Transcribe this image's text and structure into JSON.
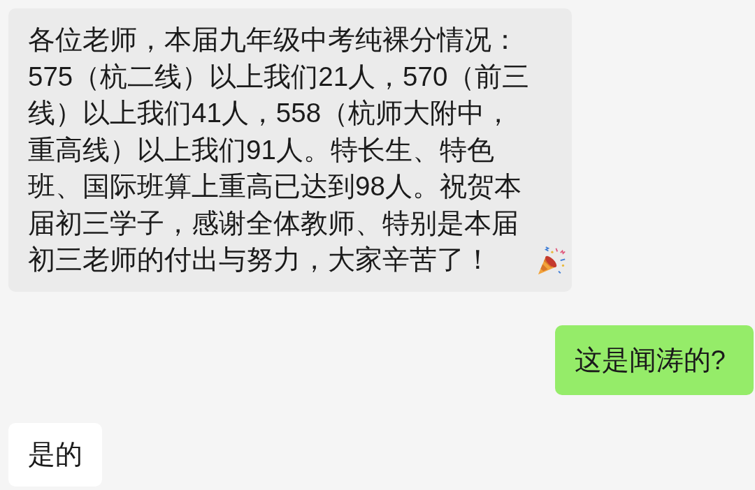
{
  "messages": [
    {
      "kind": "received",
      "highlighted": true,
      "end_icon": true,
      "text": "各位老师，本届九年级中考纯裸分情况：575（杭二线）以上我们21人，570（前三线）以上我们41人，558（杭师大附中，重高线）以上我们91人。特长生、特色班、国际班算上重高已达到98人。祝贺本届初三学子，感谢全体教师、特别是本届初三老师的付出与努力，大家辛苦了！"
    },
    {
      "kind": "sent",
      "highlighted": false,
      "end_icon": false,
      "text": "这是闻涛的?"
    },
    {
      "kind": "received",
      "highlighted": false,
      "end_icon": false,
      "text": "是的"
    }
  ]
}
